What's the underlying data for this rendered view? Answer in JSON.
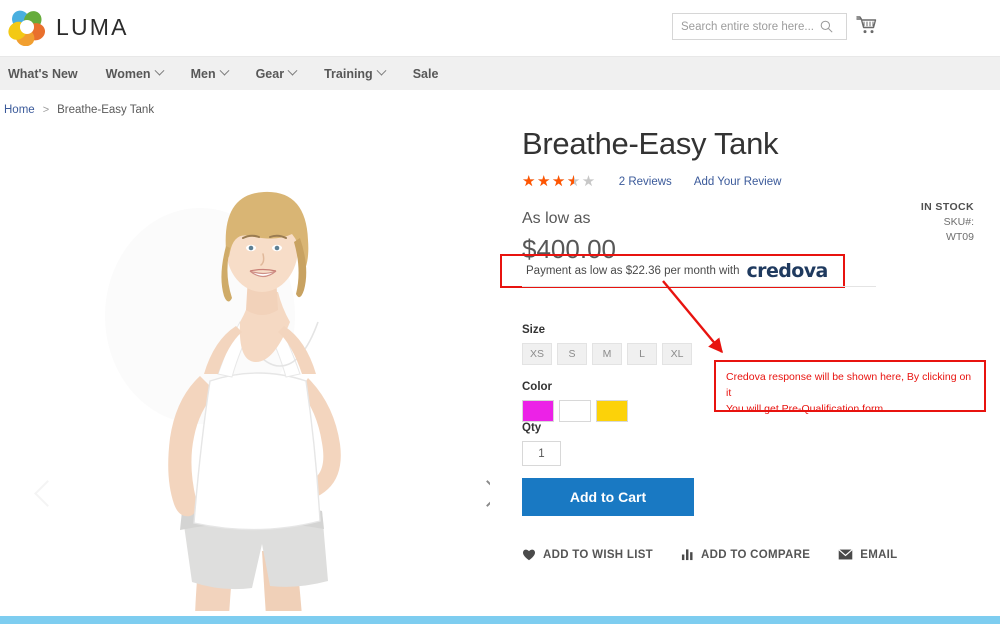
{
  "header": {
    "brand": "LUMA",
    "logo_icon": "luma-ring-logo",
    "search": {
      "placeholder": "Search entire store here...",
      "value": "",
      "icon": "search-icon"
    },
    "cart_icon": "shopping-cart-icon"
  },
  "nav": {
    "items": [
      {
        "label": "What's New",
        "has_dropdown": false
      },
      {
        "label": "Women",
        "has_dropdown": true
      },
      {
        "label": "Men",
        "has_dropdown": true
      },
      {
        "label": "Gear",
        "has_dropdown": true
      },
      {
        "label": "Training",
        "has_dropdown": true
      },
      {
        "label": "Sale",
        "has_dropdown": false
      }
    ]
  },
  "breadcrumb": {
    "home": "Home",
    "separator": ">",
    "current": "Breathe-Easy Tank"
  },
  "gallery": {
    "prev_icon": "chevron-left-icon",
    "next_icon": "chevron-right-icon",
    "alt": "Woman wearing white Breathe-Easy Tank"
  },
  "product": {
    "title": "Breathe-Easy Tank",
    "rating": {
      "stars_filled": 3.5,
      "stars_total": 5,
      "percent": 70,
      "star_color": "#ff5501",
      "empty_color": "#c7c7c7"
    },
    "reviews_link": "2  Reviews",
    "add_review_link": "Add Your Review",
    "price_label": "As low as",
    "price": "$400.00",
    "stock_status": "IN STOCK",
    "sku_label": "SKU#:",
    "sku_value": "WT09",
    "financing": {
      "text": "Payment as low as $22.36 per month with",
      "provider": "credova",
      "provider_color": "#1f3a5f",
      "highlight_color": "#e8130f"
    },
    "options": {
      "size_label": "Size",
      "sizes": [
        "XS",
        "S",
        "M",
        "L",
        "XL"
      ],
      "color_label": "Color",
      "colors": [
        {
          "name": "magenta",
          "hex": "#ec22e7"
        },
        {
          "name": "white",
          "hex": "#ffffff"
        },
        {
          "name": "yellow",
          "hex": "#fcd209"
        }
      ]
    },
    "qty_label": "Qty",
    "qty_value": "1",
    "add_to_cart": "Add to Cart",
    "actions": [
      {
        "label": "ADD TO WISH LIST",
        "icon": "heart-icon"
      },
      {
        "label": "ADD TO COMPARE",
        "icon": "bar-chart-icon"
      },
      {
        "label": "EMAIL",
        "icon": "envelope-icon"
      }
    ]
  },
  "annotation": {
    "line1": "Credova response will be shown here, By clicking on it",
    "line2": "You will get Pre-Qualification form.",
    "color": "#e8130f",
    "arrow_icon": "red-arrow-icon"
  },
  "colors": {
    "accent_blue": "#1979c3",
    "link_blue": "#3b5a9a",
    "nav_bg": "#f0f0f0",
    "footer_bar": "#7ecdf0"
  }
}
